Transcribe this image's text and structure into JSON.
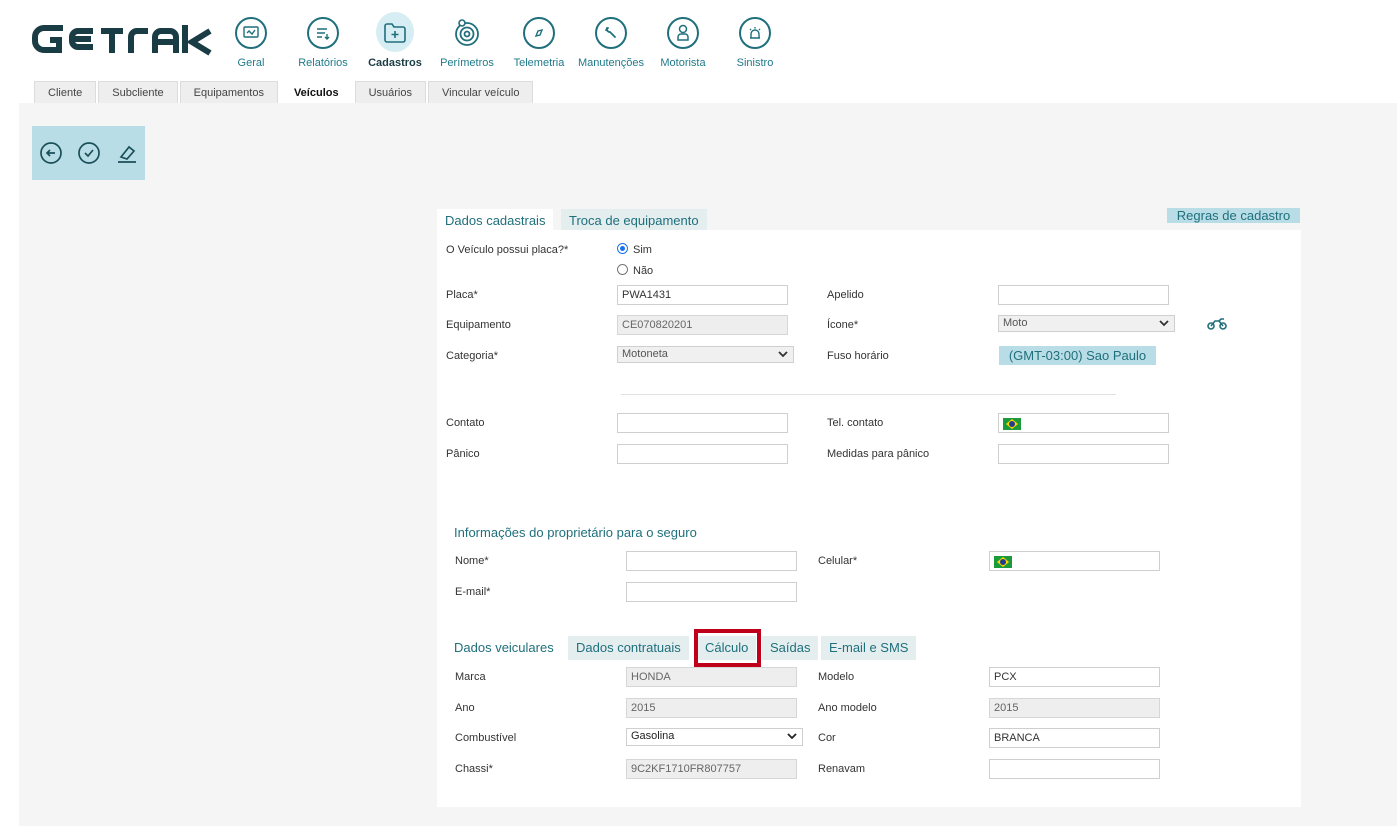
{
  "brand": {
    "logo_text": "GETRAK",
    "accent": "#1f6f7c",
    "highlight": "#c0001a"
  },
  "nav": [
    {
      "label": "Geral",
      "icon": "dashboard-icon"
    },
    {
      "label": "Relatórios",
      "icon": "report-icon"
    },
    {
      "label": "Cadastros",
      "icon": "folder-add-icon",
      "active": true
    },
    {
      "label": "Perímetros",
      "icon": "target-icon"
    },
    {
      "label": "Telemetria",
      "icon": "compass-icon"
    },
    {
      "label": "Manutenções",
      "icon": "wrench-icon"
    },
    {
      "label": "Motorista",
      "icon": "driver-icon"
    },
    {
      "label": "Sinistro",
      "icon": "alarm-icon"
    }
  ],
  "subtabs": [
    "Cliente",
    "Subcliente",
    "Equipamentos",
    "Veículos",
    "Usuários",
    "Vincular veículo"
  ],
  "subtab_active": "Veículos",
  "toolbar": {
    "back_icon": "back-arrow-icon",
    "save_icon": "check-icon",
    "clear_icon": "eraser-icon"
  },
  "form_tabs": {
    "primary": "Dados cadastrais",
    "secondary": "Troca de equipamento"
  },
  "rules_button": "Regras de cadastro",
  "plate_question": {
    "label": "O Veículo possui placa?*",
    "yes": "Sim",
    "no": "Não",
    "selected": "Sim"
  },
  "fields": {
    "placa": {
      "label": "Placa*",
      "value": "PWA1431"
    },
    "apelido": {
      "label": "Apelido",
      "value": ""
    },
    "equipamento": {
      "label": "Equipamento",
      "value": "CE070820201"
    },
    "icone": {
      "label": "Ícone*",
      "value": "Moto",
      "icon": "motorcycle-icon"
    },
    "categoria": {
      "label": "Categoria*",
      "value": "Motoneta"
    },
    "fuso": {
      "label": "Fuso horário",
      "value": "(GMT-03:00) Sao Paulo"
    },
    "contato": {
      "label": "Contato",
      "value": ""
    },
    "tel_contato": {
      "label": "Tel. contato",
      "value": ""
    },
    "panico": {
      "label": "Pânico",
      "value": ""
    },
    "medidas_panico": {
      "label": "Medidas para pânico",
      "value": ""
    }
  },
  "owner": {
    "title": "Informações do proprietário para o seguro",
    "nome": {
      "label": "Nome*",
      "value": ""
    },
    "celular": {
      "label": "Celular*",
      "value": ""
    },
    "email": {
      "label": "E-mail*",
      "value": ""
    }
  },
  "vehicle_tabs": [
    "Dados veiculares",
    "Dados contratuais",
    "Cálculo",
    "Saídas",
    "E-mail e SMS"
  ],
  "vehicle": {
    "marca": {
      "label": "Marca",
      "value": "HONDA"
    },
    "modelo": {
      "label": "Modelo",
      "value": "PCX"
    },
    "ano": {
      "label": "Ano",
      "value": "2015"
    },
    "ano_modelo": {
      "label": "Ano modelo",
      "value": "2015"
    },
    "combustivel": {
      "label": "Combustível",
      "value": "Gasolina"
    },
    "cor": {
      "label": "Cor",
      "value": "BRANCA"
    },
    "chassi": {
      "label": "Chassi*",
      "value": "9C2KF1710FR807757"
    },
    "renavam": {
      "label": "Renavam",
      "value": ""
    }
  }
}
